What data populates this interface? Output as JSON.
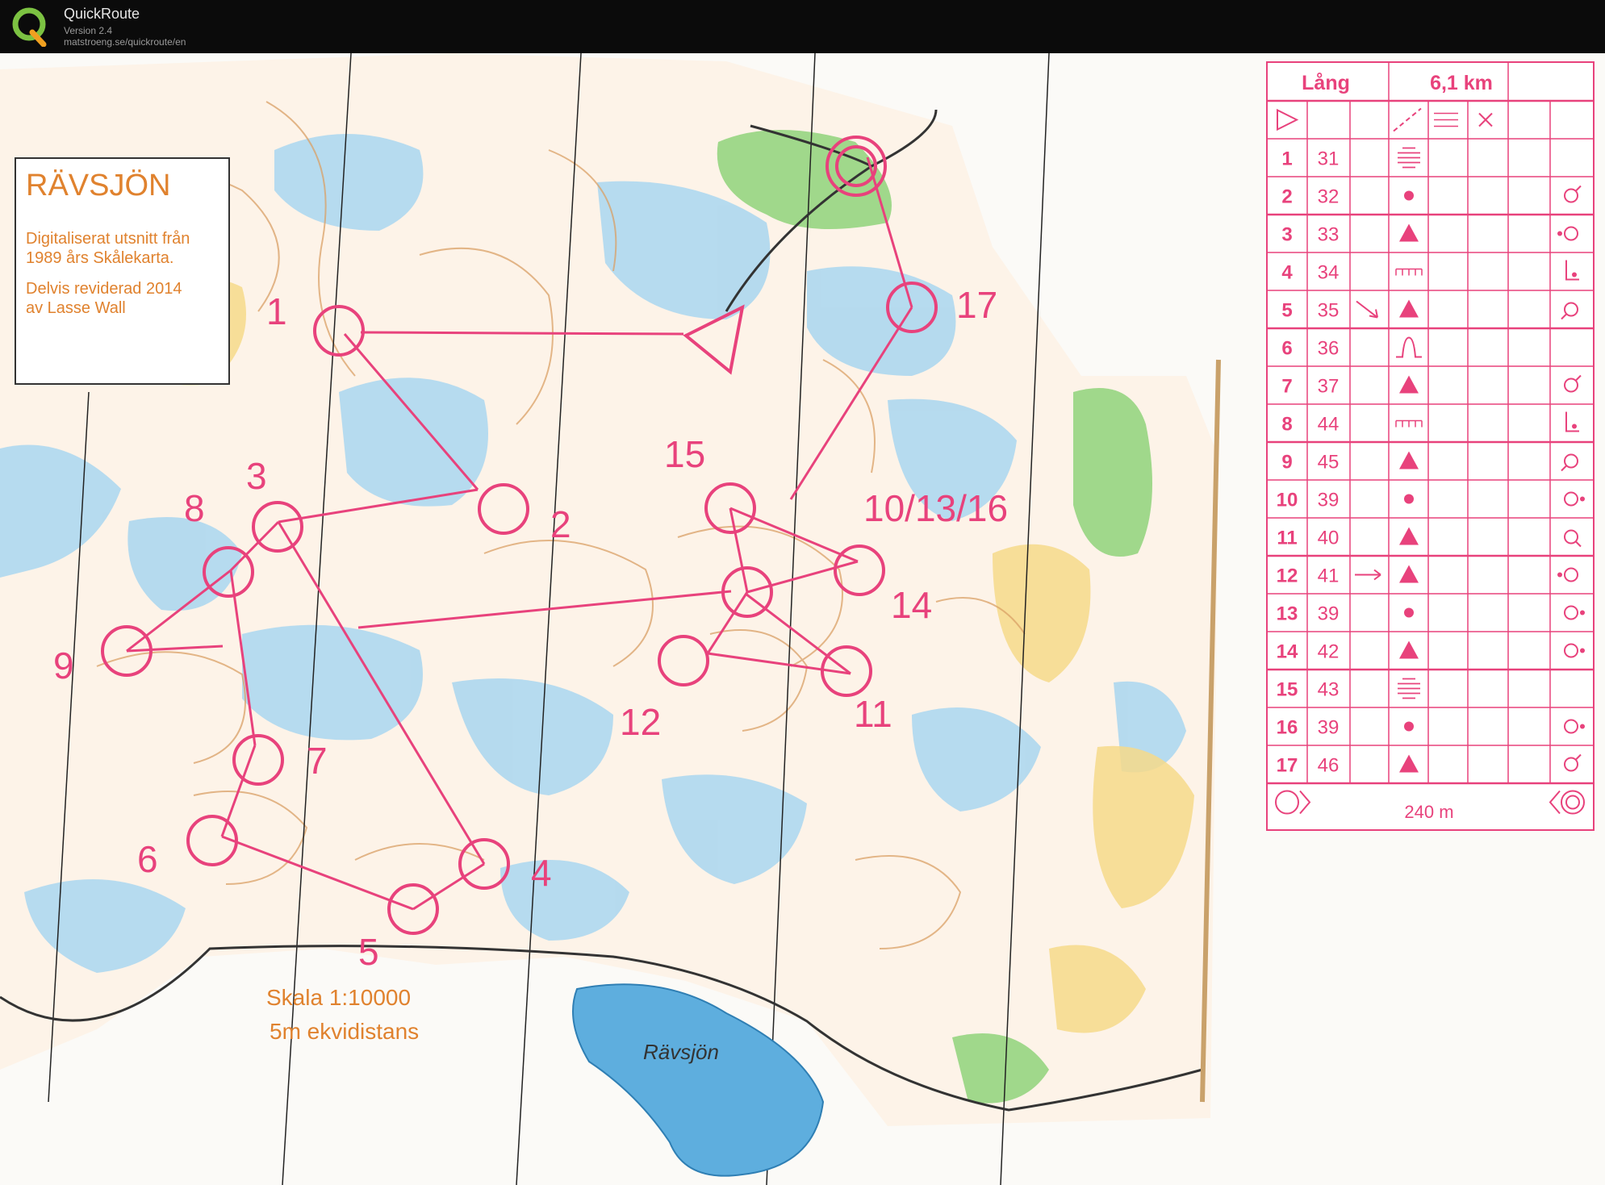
{
  "app": {
    "name": "QuickRoute",
    "version": "Version 2.4",
    "url": "matstroeng.se/quickroute/en"
  },
  "map": {
    "title": "RÄVSJÖN",
    "info_line1": "Digitaliserat utsnitt från",
    "info_line2": "1989 års Skålekarta.",
    "info_line3": "Delvis reviderad 2014",
    "info_line4": "av Lasse Wall",
    "scale": "Skala 1:10000",
    "contour": "5m ekvidistans",
    "lake_name": "Rävsjön",
    "colors": {
      "course": "#e8427c",
      "water": "#9fd0ec",
      "open": "#f6d98a",
      "green": "#8fd27a",
      "contour": "#d9a066"
    },
    "control_labels": [
      {
        "id": "c1",
        "text": "1"
      },
      {
        "id": "c2",
        "text": "2"
      },
      {
        "id": "c3",
        "text": "3"
      },
      {
        "id": "c4",
        "text": "4"
      },
      {
        "id": "c5",
        "text": "5"
      },
      {
        "id": "c6",
        "text": "6"
      },
      {
        "id": "c7",
        "text": "7"
      },
      {
        "id": "c8",
        "text": "8"
      },
      {
        "id": "c9",
        "text": "9"
      },
      {
        "id": "c10",
        "text": "10/13/16"
      },
      {
        "id": "c11",
        "text": "11"
      },
      {
        "id": "c12",
        "text": "12"
      },
      {
        "id": "c14",
        "text": "14"
      },
      {
        "id": "c15",
        "text": "15"
      },
      {
        "id": "c17",
        "text": "17"
      }
    ]
  },
  "description": {
    "course": "Lång",
    "length": "6,1 km",
    "finish_distance": "240 m",
    "rows": [
      {
        "num": "1",
        "code": "31",
        "feature": "marsh-lines",
        "direction": "",
        "detail": ""
      },
      {
        "num": "2",
        "code": "32",
        "feature": "dot",
        "direction": "",
        "detail": "ring-top-right"
      },
      {
        "num": "3",
        "code": "33",
        "feature": "triangle",
        "direction": "",
        "detail": "ring-dot-left"
      },
      {
        "num": "4",
        "code": "34",
        "feature": "comb",
        "direction": "",
        "detail": "foot-corner"
      },
      {
        "num": "5",
        "code": "35",
        "feature": "triangle",
        "direction": "arrow-down-right",
        "detail": "ring-bottom-left"
      },
      {
        "num": "6",
        "code": "36",
        "feature": "hill-profile",
        "direction": "",
        "detail": ""
      },
      {
        "num": "7",
        "code": "37",
        "feature": "triangle",
        "direction": "",
        "detail": "ring-top-right"
      },
      {
        "num": "8",
        "code": "44",
        "feature": "comb",
        "direction": "",
        "detail": "foot-corner"
      },
      {
        "num": "9",
        "code": "45",
        "feature": "triangle",
        "direction": "",
        "detail": "ring-bottom-left"
      },
      {
        "num": "10",
        "code": "39",
        "feature": "dot",
        "direction": "",
        "detail": "ring-dot-right"
      },
      {
        "num": "11",
        "code": "40",
        "feature": "triangle",
        "direction": "",
        "detail": "ring-bottom-right"
      },
      {
        "num": "12",
        "code": "41",
        "feature": "triangle",
        "direction": "arrow-right",
        "detail": "ring-dot-left"
      },
      {
        "num": "13",
        "code": "39",
        "feature": "dot",
        "direction": "",
        "detail": "ring-dot-right"
      },
      {
        "num": "14",
        "code": "42",
        "feature": "triangle",
        "direction": "",
        "detail": "ring-dot-right"
      },
      {
        "num": "15",
        "code": "43",
        "feature": "marsh-lines",
        "direction": "",
        "detail": ""
      },
      {
        "num": "16",
        "code": "39",
        "feature": "dot",
        "direction": "",
        "detail": "ring-dot-right"
      },
      {
        "num": "17",
        "code": "46",
        "feature": "triangle",
        "direction": "",
        "detail": "ring-top-right"
      }
    ]
  }
}
